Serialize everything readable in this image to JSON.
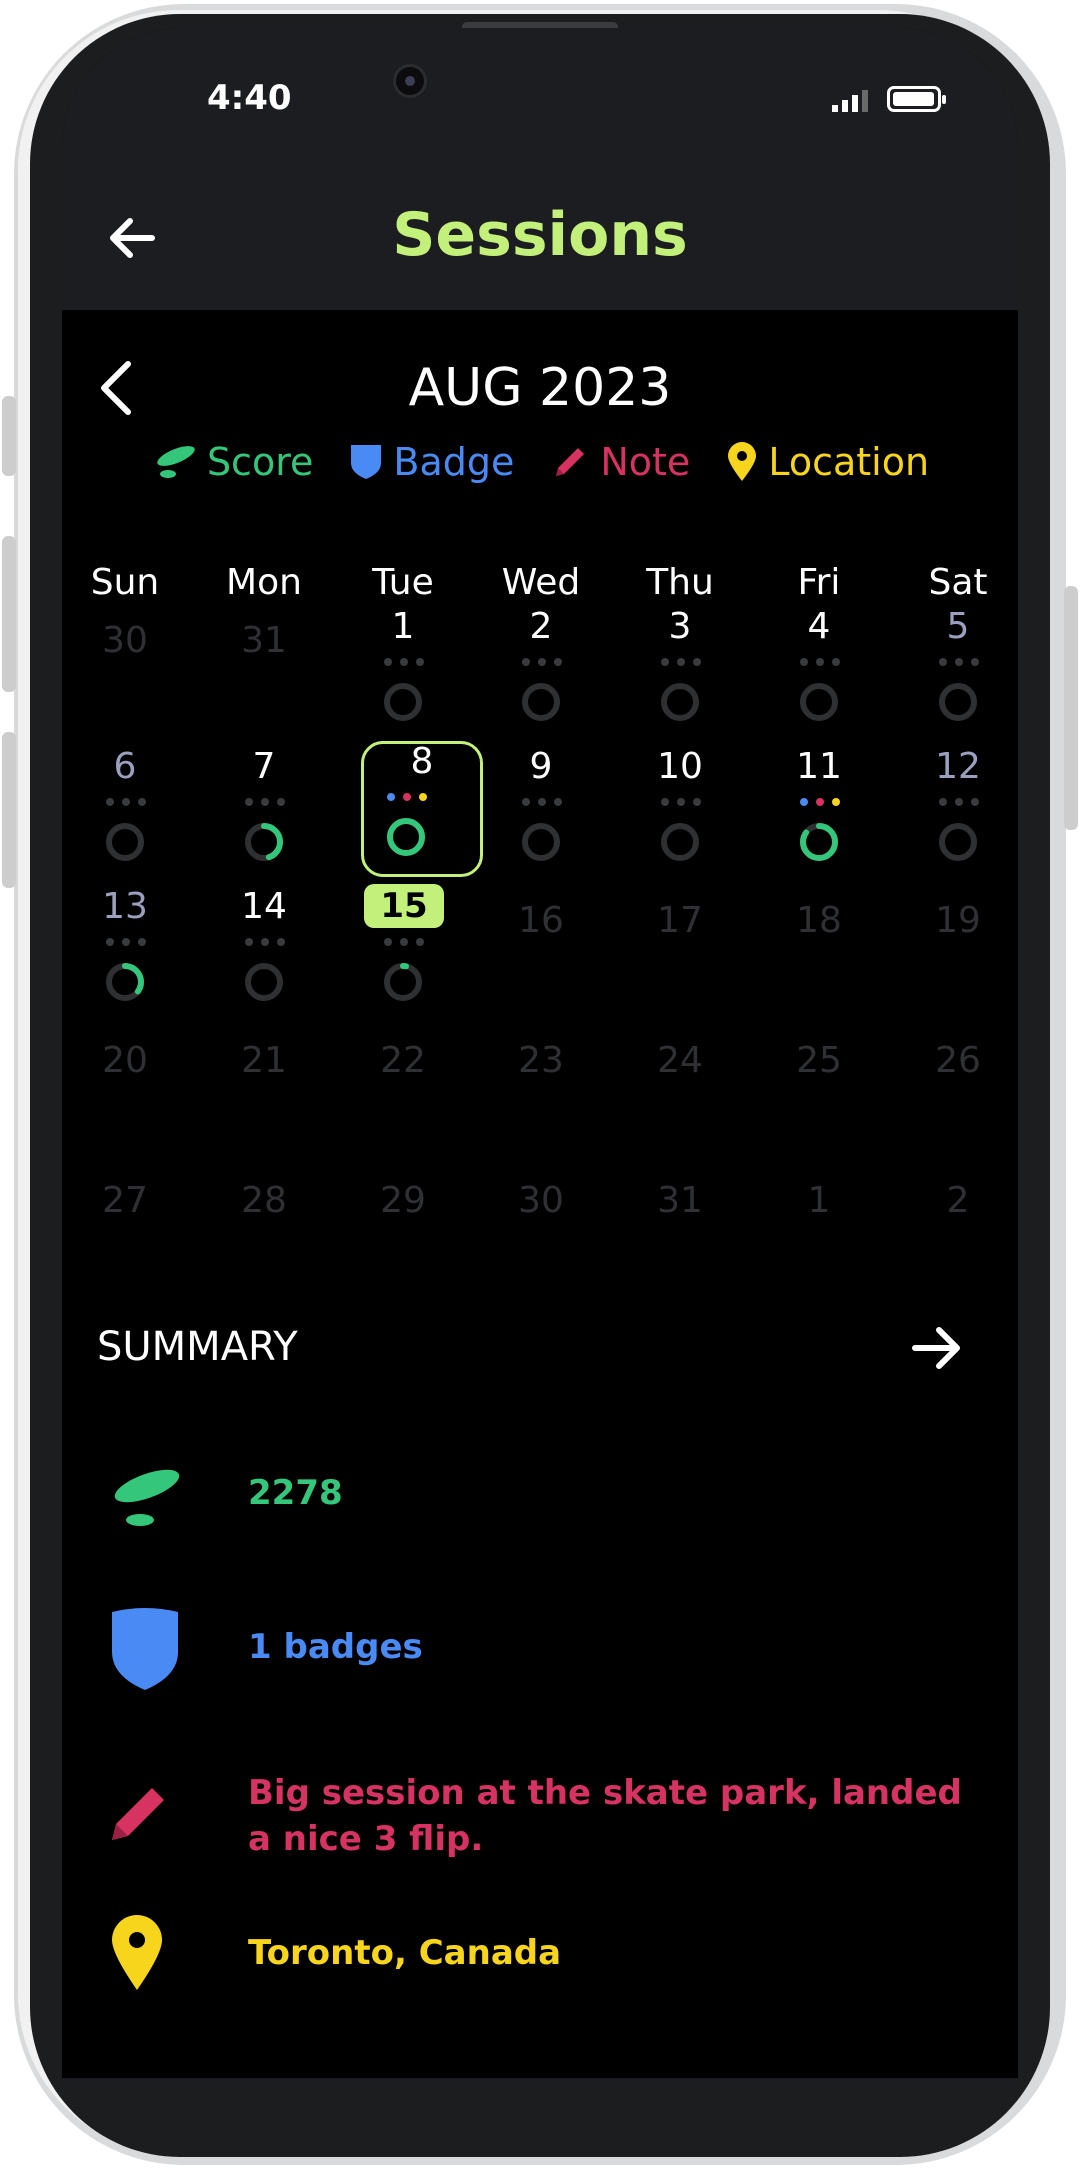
{
  "status_bar": {
    "time": "4:40"
  },
  "app_bar": {
    "title": "Sessions"
  },
  "calendar": {
    "month_label": "AUG 2023",
    "weekdays": [
      "Sun",
      "Mon",
      "Tue",
      "Wed",
      "Thu",
      "Fri",
      "Sat"
    ],
    "weeks": [
      [
        {
          "d": "30",
          "t": "other"
        },
        {
          "d": "31",
          "t": "other"
        },
        {
          "d": "1",
          "t": "day",
          "r": 0
        },
        {
          "d": "2",
          "t": "day",
          "r": 0
        },
        {
          "d": "3",
          "t": "day",
          "r": 0
        },
        {
          "d": "4",
          "t": "day",
          "r": 0
        },
        {
          "d": "5",
          "t": "weekend",
          "r": 0
        }
      ],
      [
        {
          "d": "6",
          "t": "weekend",
          "r": 0
        },
        {
          "d": "7",
          "t": "day",
          "r": 0.45
        },
        {
          "d": "8",
          "t": "day",
          "r": 1,
          "sel": true,
          "dots": [
            "blue",
            "pink",
            "yellow"
          ]
        },
        {
          "d": "9",
          "t": "day",
          "r": 0
        },
        {
          "d": "10",
          "t": "day",
          "r": 0
        },
        {
          "d": "11",
          "t": "day",
          "r": 0.85,
          "dots": [
            "blue",
            "pink",
            "yellow"
          ]
        },
        {
          "d": "12",
          "t": "weekend",
          "r": 0
        }
      ],
      [
        {
          "d": "13",
          "t": "weekend",
          "r": 0.35
        },
        {
          "d": "14",
          "t": "day",
          "r": 0
        },
        {
          "d": "15",
          "t": "today",
          "r": 0.03
        },
        {
          "d": "16",
          "t": "other"
        },
        {
          "d": "17",
          "t": "other"
        },
        {
          "d": "18",
          "t": "other"
        },
        {
          "d": "19",
          "t": "other"
        }
      ],
      [
        {
          "d": "20",
          "t": "other"
        },
        {
          "d": "21",
          "t": "other"
        },
        {
          "d": "22",
          "t": "other"
        },
        {
          "d": "23",
          "t": "other"
        },
        {
          "d": "24",
          "t": "other"
        },
        {
          "d": "25",
          "t": "other"
        },
        {
          "d": "26",
          "t": "other"
        }
      ],
      [
        {
          "d": "27",
          "t": "other"
        },
        {
          "d": "28",
          "t": "other"
        },
        {
          "d": "29",
          "t": "other"
        },
        {
          "d": "30",
          "t": "other"
        },
        {
          "d": "31",
          "t": "other"
        },
        {
          "d": "1",
          "t": "other"
        },
        {
          "d": "2",
          "t": "other"
        }
      ]
    ]
  },
  "legend": [
    {
      "label": "Score",
      "color": "#34c77b",
      "icon": "skateboard-icon"
    },
    {
      "label": "Badge",
      "color": "#4a8af4",
      "icon": "shield-icon"
    },
    {
      "label": "Note",
      "color": "#d63363",
      "icon": "pencil-icon"
    },
    {
      "label": "Location",
      "color": "#f7d51d",
      "icon": "location-pin-icon"
    }
  ],
  "summary": {
    "title": "SUMMARY",
    "score": "2278",
    "badges": "1 badges",
    "note": "Big session at the skate park, landed a nice 3 flip.",
    "location": "Toronto, Canada"
  },
  "colors": {
    "accent": "#c3f07a",
    "score": "#34c77b",
    "badge": "#4a8af4",
    "note": "#d63363",
    "location": "#f7d51d"
  }
}
